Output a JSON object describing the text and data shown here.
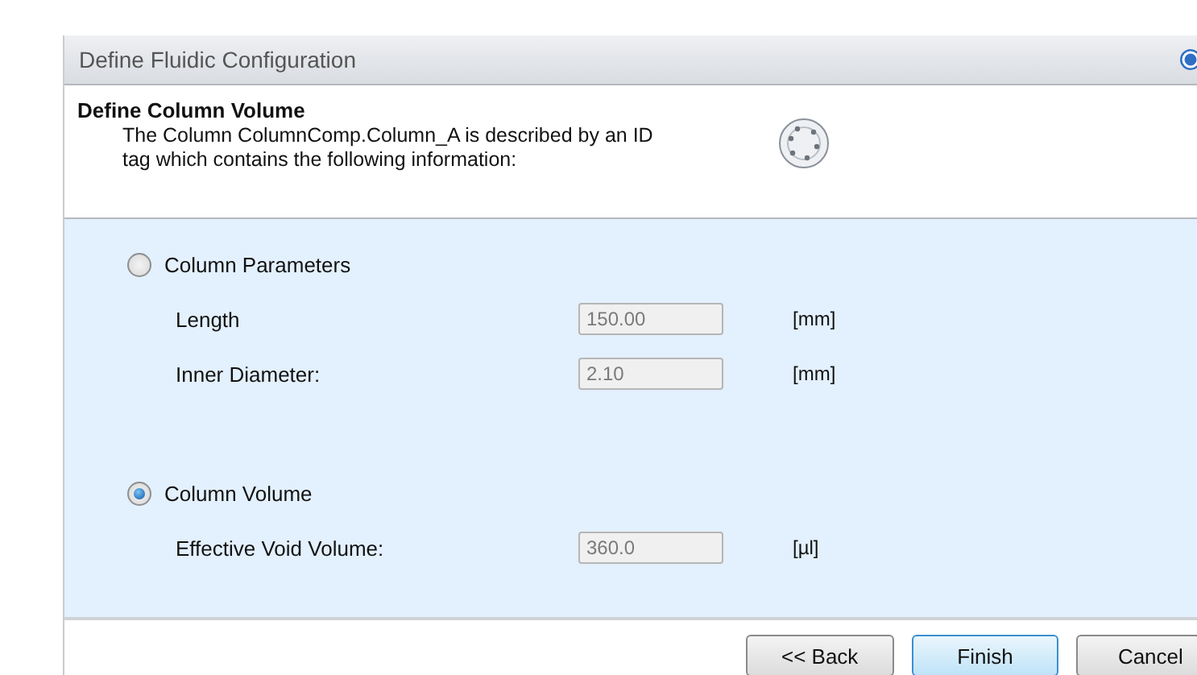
{
  "dialog": {
    "title": "Define Fluidic Configuration",
    "header": {
      "title": "Define Column Volume",
      "description": "The Column ColumnComp.Column_A is described by an ID tag which contains the following information:"
    },
    "options": [
      {
        "label": "Column Parameters",
        "selected": false,
        "fields": [
          {
            "label": "Length",
            "value": "150.00",
            "unit": "[mm]",
            "disabled": true
          },
          {
            "label": "Inner Diameter:",
            "value": "2.10",
            "unit": "[mm]",
            "disabled": true
          }
        ]
      },
      {
        "label": "Column Volume",
        "selected": true,
        "fields": [
          {
            "label": "Effective Void Volume:",
            "value": "360.0",
            "unit": "[µl]",
            "disabled": true
          }
        ]
      }
    ],
    "buttons": [
      {
        "label": "<< Back",
        "focused": false
      },
      {
        "label": "Finish",
        "focused": true
      },
      {
        "label": "Cancel",
        "focused": false
      }
    ]
  }
}
